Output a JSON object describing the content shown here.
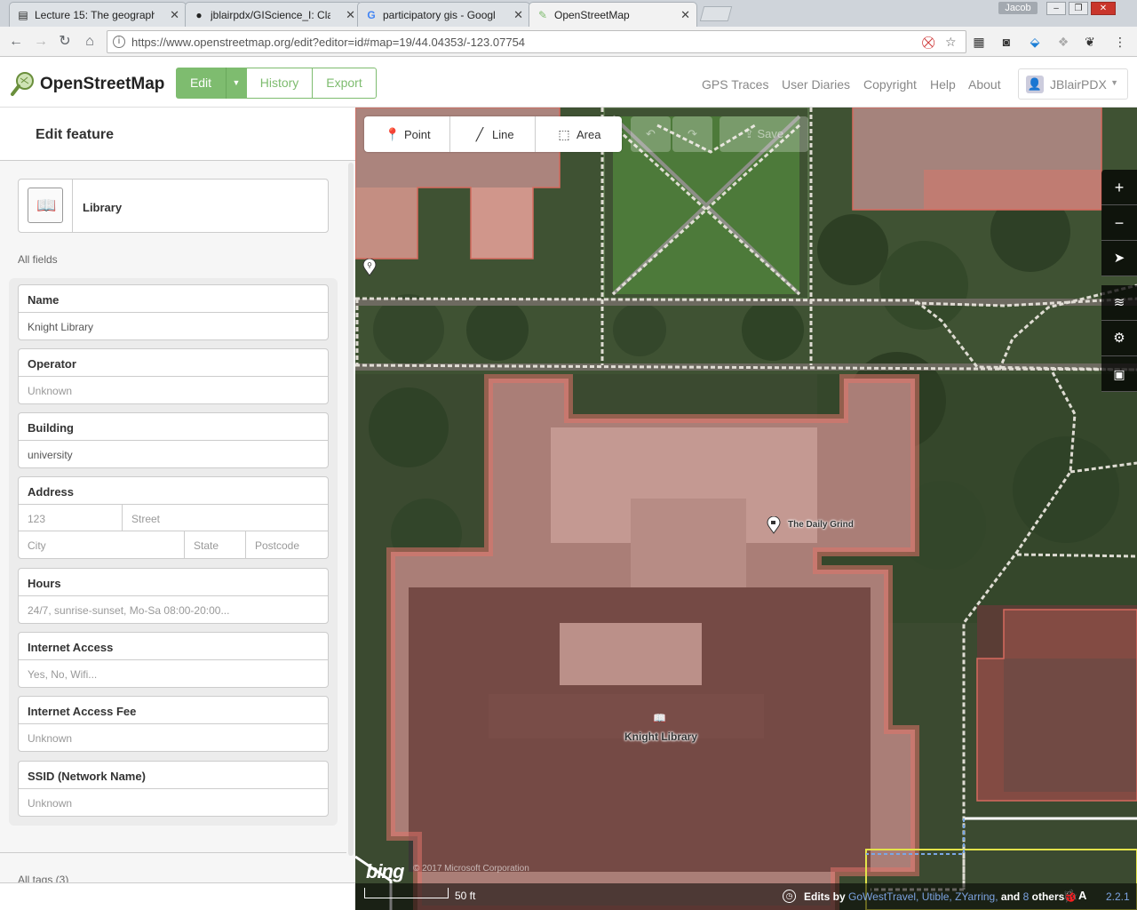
{
  "browser": {
    "tabs": [
      {
        "title": "Lecture 15: The geograph",
        "icon": "document-icon"
      },
      {
        "title": "jblairpdx/GIScience_I: Cla",
        "icon": "github-icon"
      },
      {
        "title": "participatory gis - Googl",
        "icon": "google-icon"
      },
      {
        "title": "OpenStreetMap",
        "icon": "osm-icon"
      }
    ],
    "user": "Jacob",
    "url": "https://www.openstreetmap.org/edit?editor=id#map=19/44.04353/-123.07754"
  },
  "header": {
    "site_title": "OpenStreetMap",
    "edit_label": "Edit",
    "history_label": "History",
    "export_label": "Export",
    "nav": [
      "GPS Traces",
      "User Diaries",
      "Copyright",
      "Help",
      "About"
    ],
    "username": "JBlairPDX",
    "accent": "#7ebc6f"
  },
  "sidebar": {
    "title": "Edit feature",
    "preset": {
      "label": "Library",
      "icon": "book-icon"
    },
    "all_fields": "All fields",
    "fields": [
      {
        "label": "Name",
        "value": "Knight Library",
        "placeholder": false
      },
      {
        "label": "Operator",
        "value": "Unknown",
        "placeholder": true
      },
      {
        "label": "Building",
        "value": "university",
        "placeholder": false
      }
    ],
    "address": {
      "label": "Address",
      "housenumber": "123",
      "street": "Street",
      "city": "City",
      "state": "State",
      "postcode": "Postcode"
    },
    "fields2": [
      {
        "label": "Hours",
        "value": "24/7, sunrise-sunset, Mo-Sa 08:00-20:00...",
        "placeholder": true
      },
      {
        "label": "Internet Access",
        "value": "Yes, No, Wifi...",
        "placeholder": true
      },
      {
        "label": "Internet Access Fee",
        "value": "Unknown",
        "placeholder": true
      },
      {
        "label": "SSID (Network Name)",
        "value": "Unknown",
        "placeholder": true
      }
    ],
    "all_tags": "All tags (3)"
  },
  "map": {
    "modes": {
      "point": "Point",
      "line": "Line",
      "area": "Area"
    },
    "save": "Save",
    "controls": [
      "zoom-in-icon",
      "zoom-out-icon",
      "geolocate-icon",
      "layers-icon",
      "map-data-icon",
      "help-icon"
    ],
    "labels": {
      "cafe": "The Daily Grind",
      "library": "Knight Library"
    },
    "imagery": "bing",
    "imagery_copyright": "© 2017 Microsoft Corporation",
    "scale": "50 ft",
    "edits_prefix": "Edits by",
    "editors": [
      "GoWestTravel,",
      "Utible,",
      "ZYarring,"
    ],
    "edits_and": "and",
    "others_count": "8",
    "others_suffix": "others",
    "version": "2.2.1"
  }
}
